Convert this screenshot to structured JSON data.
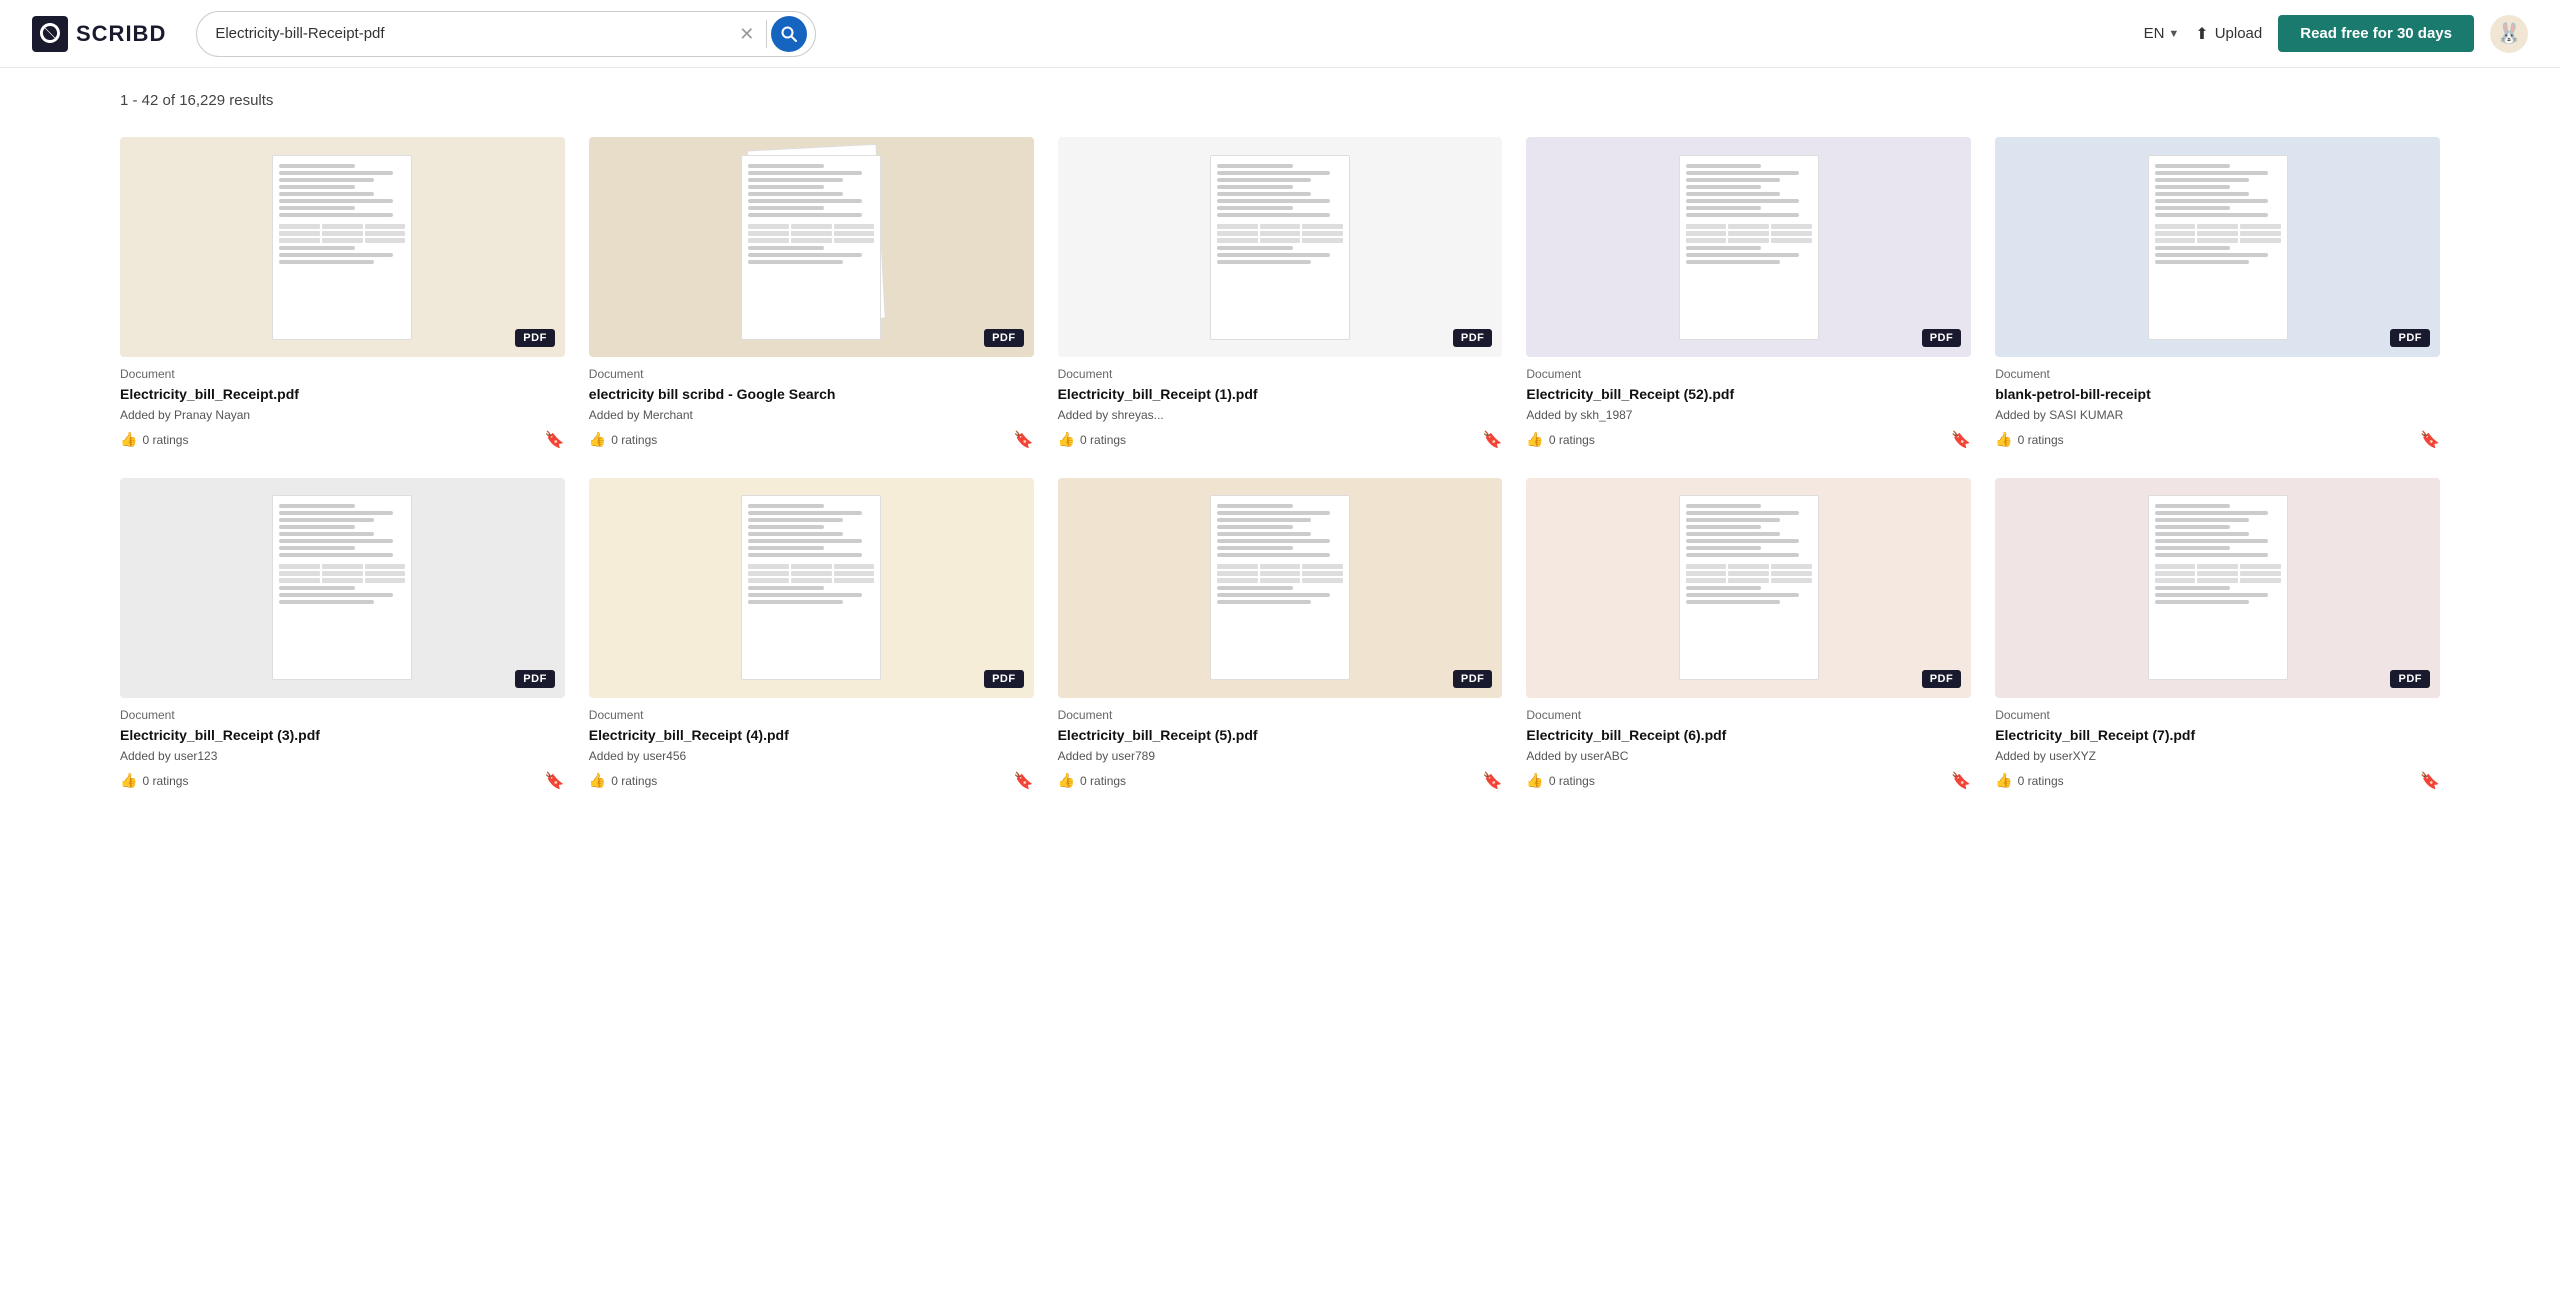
{
  "header": {
    "logo_text": "SCRIBD",
    "search_value": "Electricity-bill-Receipt-pdf",
    "lang": "EN",
    "upload_label": "Upload",
    "read_free_label": "Read free for 30 days"
  },
  "results": {
    "count_text": "1 - 42 of 16,229 results"
  },
  "cards": [
    {
      "type": "Document",
      "title": "Electricity_bill_Receipt.pdf",
      "author": "Added by Pranay Nayan",
      "ratings": "0 ratings",
      "bg": "bg-beige"
    },
    {
      "type": "Document",
      "title": "electricity bill scribd - Google Search",
      "author": "Added by Merchant",
      "ratings": "0 ratings",
      "bg": "bg-tan"
    },
    {
      "type": "Document",
      "title": "Electricity_bill_Receipt (1).pdf",
      "author": "Added by shreyas...",
      "ratings": "0 ratings",
      "bg": "bg-light"
    },
    {
      "type": "Document",
      "title": "Electricity_bill_Receipt (52).pdf",
      "author": "Added by skh_1987",
      "ratings": "0 ratings",
      "bg": "bg-lavender"
    },
    {
      "type": "Document",
      "title": "blank-petrol-bill-receipt",
      "author": "Added by SASI KUMAR",
      "ratings": "0 ratings",
      "bg": "bg-blue-gray"
    },
    {
      "type": "Document",
      "title": "Electricity_bill_Receipt (3).pdf",
      "author": "Added by user123",
      "ratings": "0 ratings",
      "bg": "bg-gray"
    },
    {
      "type": "Document",
      "title": "Electricity_bill_Receipt (4).pdf",
      "author": "Added by user456",
      "ratings": "0 ratings",
      "bg": "bg-cream"
    },
    {
      "type": "Document",
      "title": "Electricity_bill_Receipt (5).pdf",
      "author": "Added by user789",
      "ratings": "0 ratings",
      "bg": "bg-warm"
    },
    {
      "type": "Document",
      "title": "Electricity_bill_Receipt (6).pdf",
      "author": "Added by userABC",
      "ratings": "0 ratings",
      "bg": "bg-peach"
    },
    {
      "type": "Document",
      "title": "Electricity_bill_Receipt (7).pdf",
      "author": "Added by userXYZ",
      "ratings": "0 ratings",
      "bg": "bg-rose"
    }
  ]
}
